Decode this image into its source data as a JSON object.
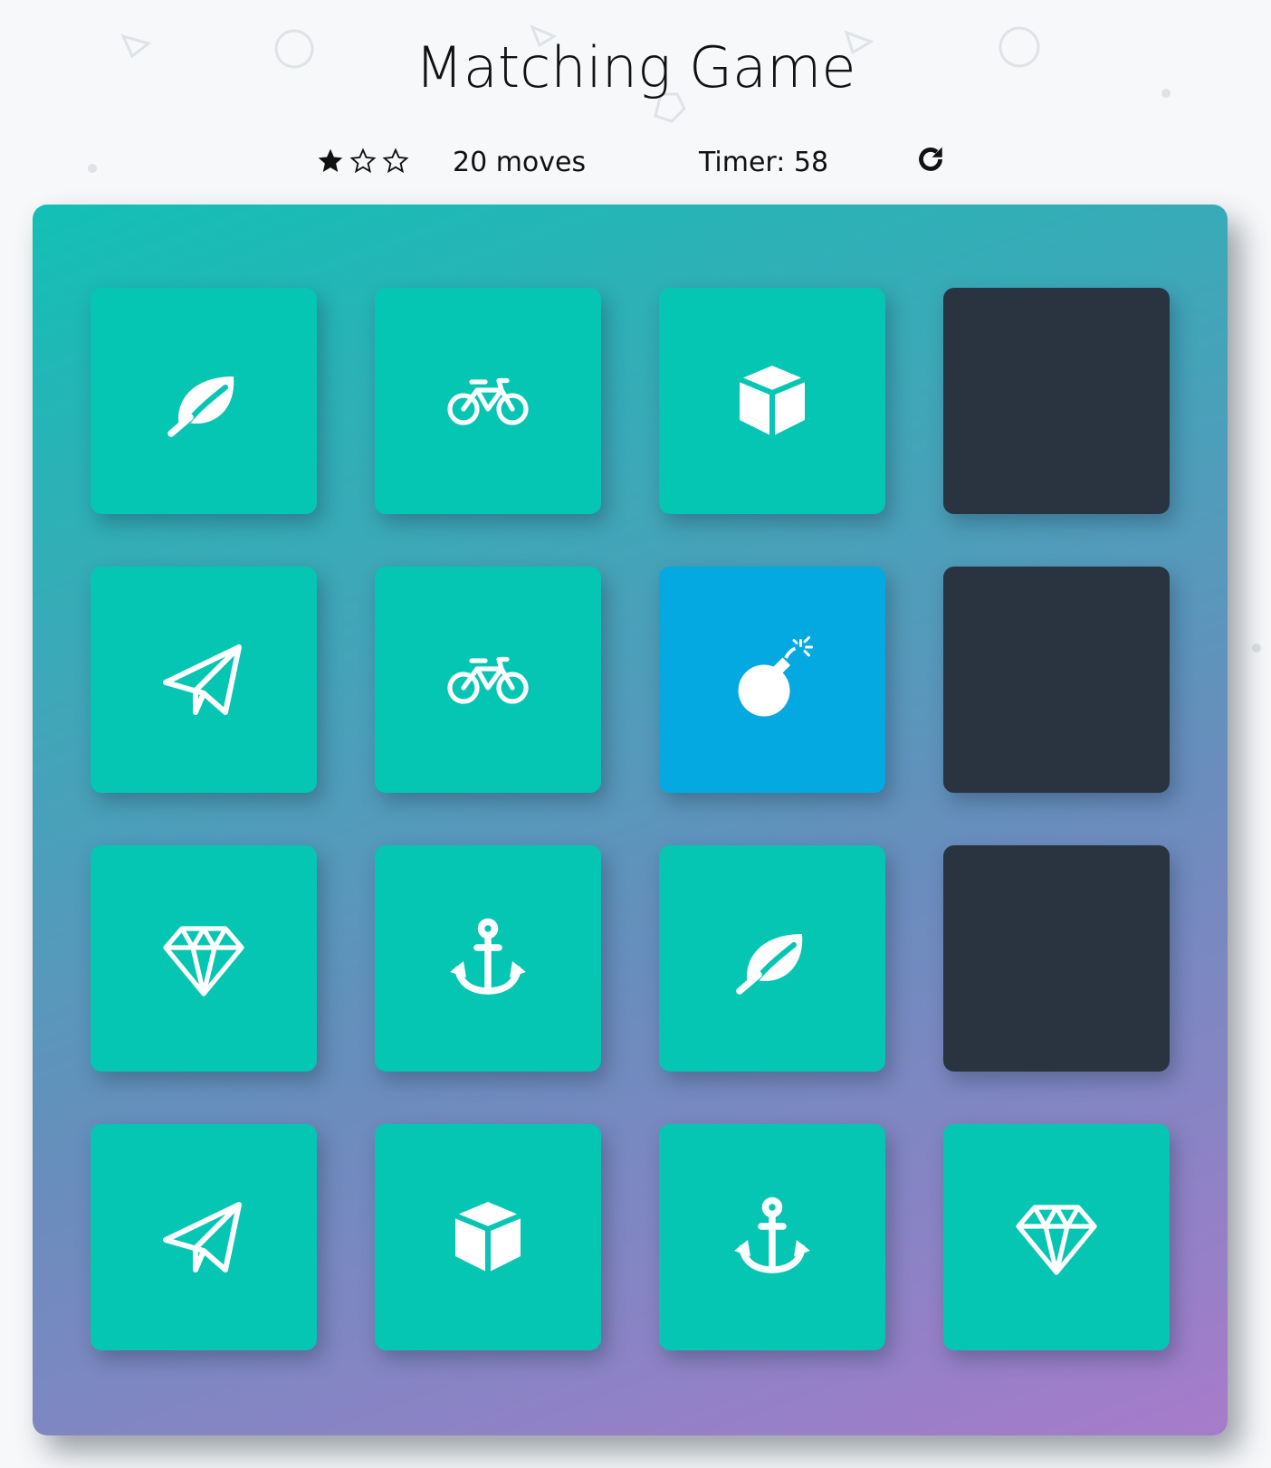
{
  "title": "Matching Game",
  "score": {
    "stars": [
      "filled",
      "empty",
      "empty"
    ],
    "moves_label": "20 moves",
    "timer_label": "Timer: 58",
    "restart_icon": "redo-icon"
  },
  "colors": {
    "card_matched": "#05c5b3",
    "card_open": "#03a9e0",
    "card_closed": "#2a3441",
    "deck_gradient_start": "#12c0b4",
    "deck_gradient_end": "#a77bcb"
  },
  "deck": {
    "rows": 4,
    "cols": 4,
    "cards": [
      {
        "icon": "leaf-icon",
        "state": "match"
      },
      {
        "icon": "bicycle-icon",
        "state": "match"
      },
      {
        "icon": "cube-icon",
        "state": "match"
      },
      {
        "icon": "",
        "state": "closed"
      },
      {
        "icon": "paper-plane-icon",
        "state": "match"
      },
      {
        "icon": "bicycle-icon",
        "state": "match"
      },
      {
        "icon": "bomb-icon",
        "state": "open"
      },
      {
        "icon": "",
        "state": "closed"
      },
      {
        "icon": "diamond-icon",
        "state": "match"
      },
      {
        "icon": "anchor-icon",
        "state": "match"
      },
      {
        "icon": "leaf-icon",
        "state": "match"
      },
      {
        "icon": "",
        "state": "closed"
      },
      {
        "icon": "paper-plane-icon",
        "state": "match"
      },
      {
        "icon": "cube-icon",
        "state": "match"
      },
      {
        "icon": "anchor-icon",
        "state": "match"
      },
      {
        "icon": "diamond-icon",
        "state": "match"
      }
    ]
  }
}
